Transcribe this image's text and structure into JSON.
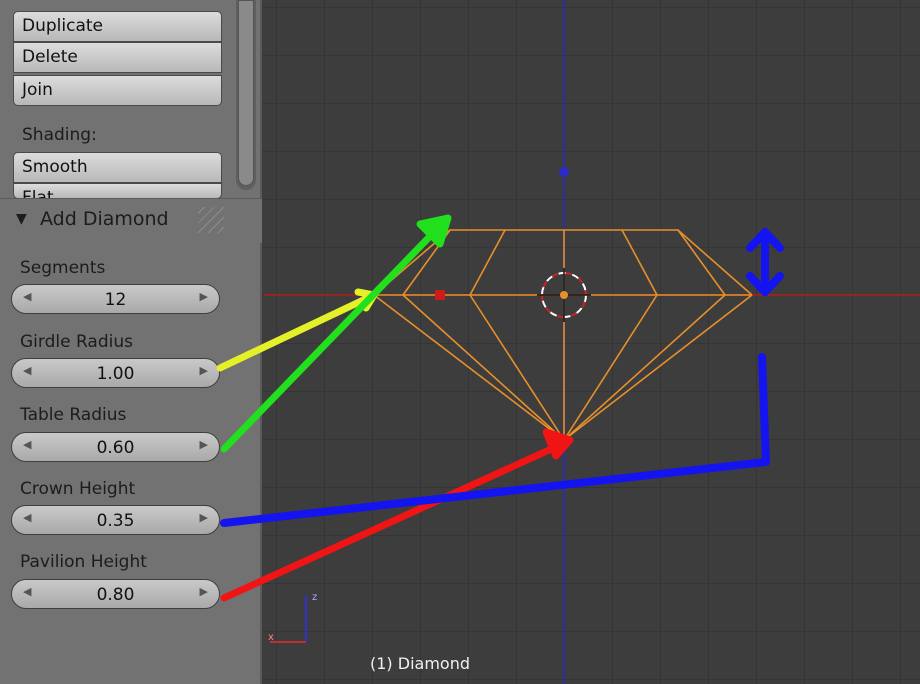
{
  "toolshelf": {
    "object_buttons": [
      "Duplicate",
      "Delete",
      "Join"
    ],
    "shading_label": "Shading:",
    "shading_buttons": [
      "Smooth",
      "Flat"
    ]
  },
  "operator_panel": {
    "title": "Add Diamond",
    "properties": [
      {
        "label": "Segments",
        "value": "12"
      },
      {
        "label": "Girdle Radius",
        "value": "1.00"
      },
      {
        "label": "Table Radius",
        "value": "0.60"
      },
      {
        "label": "Crown Height",
        "value": "0.35"
      },
      {
        "label": "Pavilion Height",
        "value": "0.80"
      }
    ]
  },
  "viewport": {
    "object_name": "(1) Diamond",
    "axis_labels": {
      "x": "x",
      "z": "z"
    }
  },
  "colors": {
    "wireframe": "#e8902a",
    "x_axis": "#b02020",
    "z_axis": "#2b2bc8",
    "girdle_arrow": "#e4f028",
    "table_arrow": "#22e01e",
    "crown_arrow": "#1414f0",
    "pavilion_arrow": "#f01414"
  }
}
